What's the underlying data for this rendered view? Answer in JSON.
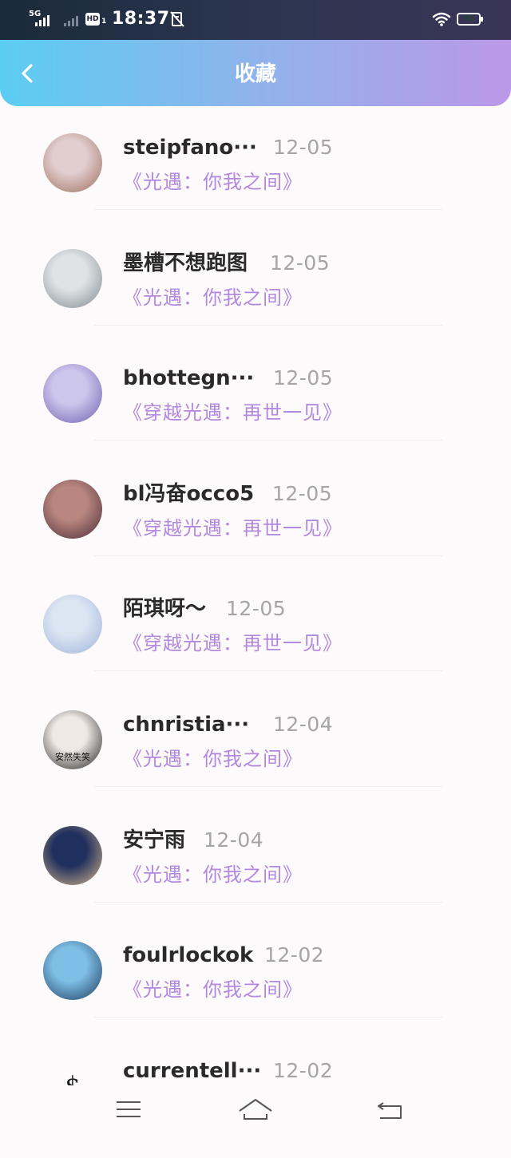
{
  "status_bar": {
    "network_label": "5G",
    "hd_label": "HD",
    "hd_sub": "1",
    "time": "18:37",
    "battery_level": "62",
    "battery_fraction": 0.62
  },
  "header": {
    "back_icon": "chevron-left-icon",
    "title": "收藏"
  },
  "items": [
    {
      "name": "steipfano···",
      "date": "12-05",
      "work": "《光遇：你我之间》",
      "avatar": "avatar-girl-photo",
      "avatar_colors": [
        "#e2cdcf",
        "#9c6e5c"
      ]
    },
    {
      "name": "墨槽不想跑图",
      "date": "12-05",
      "work": "《光遇：你我之间》",
      "avatar": "avatar-anime-white-hair",
      "avatar_colors": [
        "#dfe3e6",
        "#7f8a90"
      ]
    },
    {
      "name": "bhottegn···",
      "date": "12-05",
      "work": "《穿越光遇：再世一见》",
      "avatar": "avatar-anime-purple",
      "avatar_colors": [
        "#cdc6ec",
        "#6d5fb0"
      ]
    },
    {
      "name": "bl冯奋occo5",
      "date": "12-05",
      "work": "《穿越光遇：再世一见》",
      "avatar": "avatar-woman-photo",
      "avatar_colors": [
        "#b98780",
        "#4a2a36"
      ]
    },
    {
      "name": "陌琪呀～",
      "date": "12-05",
      "work": "《穿越光遇：再世一见》",
      "avatar": "avatar-anime-pastel",
      "avatar_colors": [
        "#dce6f3",
        "#9fb2d8"
      ]
    },
    {
      "name": "chnristia···",
      "date": "12-04",
      "work": "《光遇：你我之间》",
      "avatar": "avatar-photo-caption",
      "avatar_colors": [
        "#efe9e5",
        "#1f1d1d"
      ],
      "avatar_text": "安然失笑"
    },
    {
      "name": "安宁雨",
      "date": "12-04",
      "work": "《光遇：你我之间》",
      "avatar": "avatar-anime-space",
      "avatar_colors": [
        "#1f2f5e",
        "#d9b98a"
      ]
    },
    {
      "name": "foulrlockok",
      "date": "12-02",
      "work": "《光遇：你我之间》",
      "avatar": "avatar-landscape-lake",
      "avatar_colors": [
        "#7fbfe7",
        "#1c3a5a"
      ]
    },
    {
      "name": "currentell···",
      "date": "12-02",
      "work": "",
      "avatar": "avatar-dollar-sign",
      "avatar_text": "$"
    }
  ],
  "nav_bar": {
    "menu_icon": "menu-icon",
    "home_icon": "home-icon",
    "back_icon": "back-icon"
  },
  "colors": {
    "header_gradient": [
      "#5ccdf2",
      "#8fb3ea",
      "#bc98e8"
    ],
    "work_title": "#b389e0",
    "date": "#a5a5a5",
    "name": "#2a2a2a"
  }
}
